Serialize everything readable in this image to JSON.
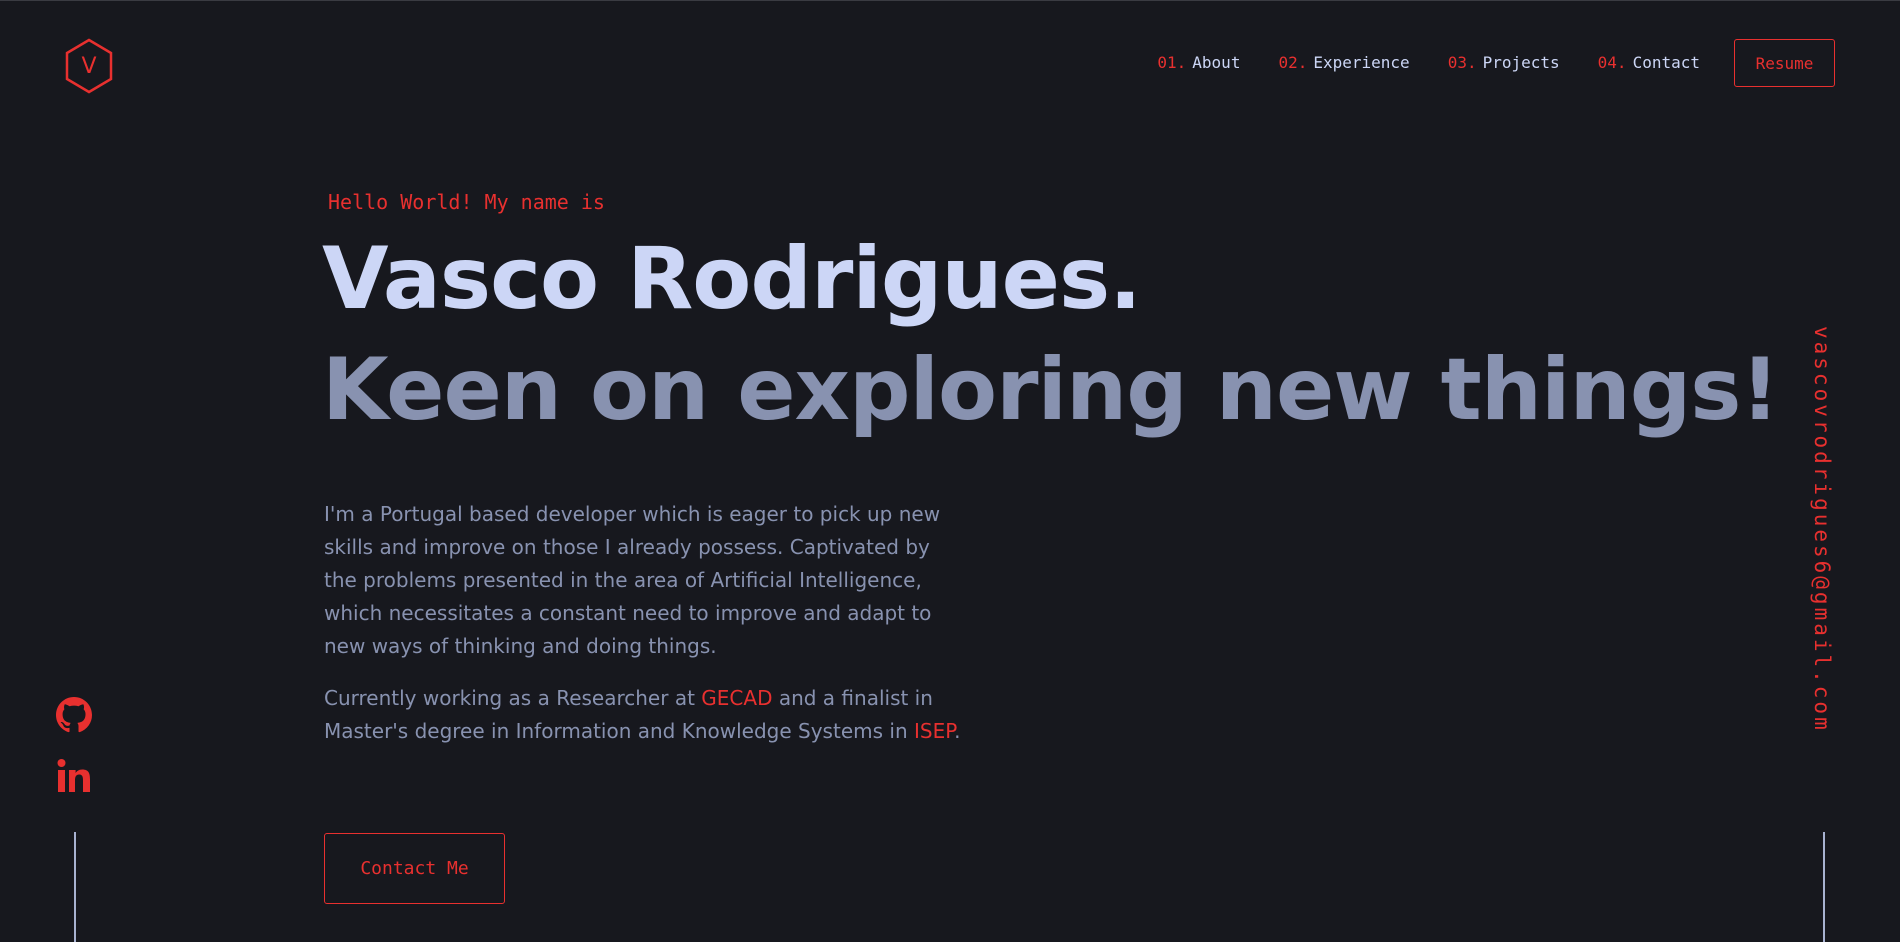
{
  "header": {
    "logo_letter": "V",
    "nav": [
      {
        "num": "01.",
        "label": "About"
      },
      {
        "num": "02.",
        "label": "Experience"
      },
      {
        "num": "03.",
        "label": "Projects"
      },
      {
        "num": "04.",
        "label": "Contact"
      }
    ],
    "resume_label": "Resume"
  },
  "hero": {
    "greeting": "Hello World! My name is",
    "name": "Vasco Rodrigues.",
    "tagline": "Keen on exploring new things!",
    "bio_p1": "I'm a Portugal based developer which is eager to pick up new skills and improve on those I already possess. Captivated by the problems presented in the area of Artificial Intelligence, which necessitates a constant need to improve and adapt to new ways of thinking and doing things.",
    "bio_p2_part1": "Currently working as a Researcher at ",
    "bio_p2_link1": "GECAD",
    "bio_p2_part2": " and a finalist in Master's degree in Information and Knowledge Systems in ",
    "bio_p2_link2": "ISEP",
    "bio_p2_part3": ".",
    "contact_label": "Contact Me"
  },
  "side": {
    "email": "vascovrodrigues6@gmail.com",
    "social_icons": [
      "github-icon",
      "linkedin-icon"
    ]
  },
  "colors": {
    "background": "#17181e",
    "accent": "#e8302f",
    "heading": "#ccd6f6",
    "text": "#8892b0"
  }
}
